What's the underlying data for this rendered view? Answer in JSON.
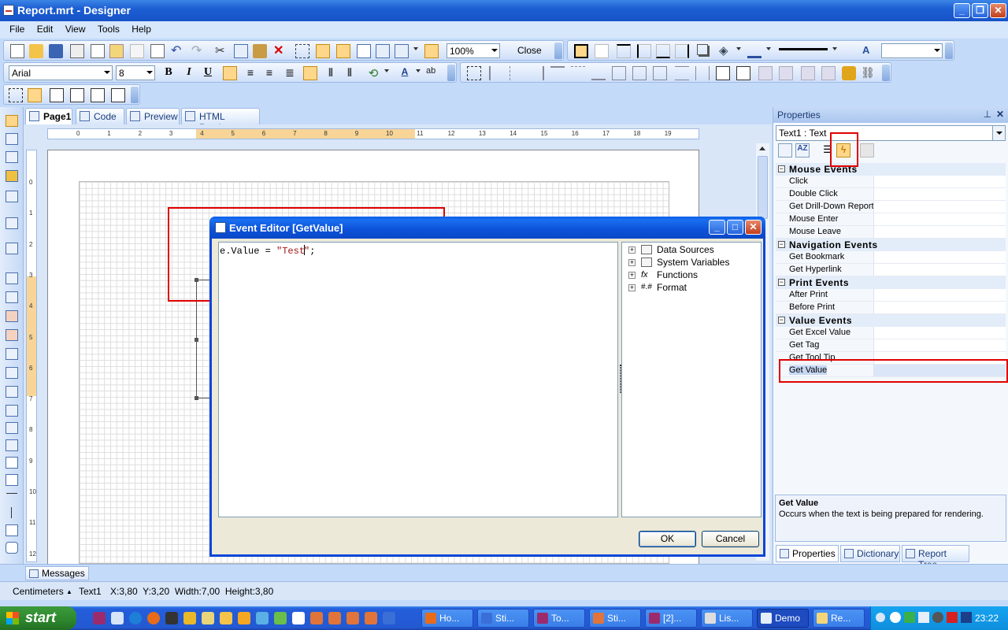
{
  "window": {
    "title": "Report.mrt - Designer"
  },
  "menu": [
    "File",
    "Edit",
    "View",
    "Tools",
    "Help"
  ],
  "toolbar": {
    "zoom": "100%",
    "close_label": "Close",
    "font_name": "Arial",
    "font_size": "8"
  },
  "tabs": [
    {
      "label": "Page1"
    },
    {
      "label": "Code"
    },
    {
      "label": "Preview"
    },
    {
      "label": "HTML Preview"
    }
  ],
  "hruler_ticks": [
    "0",
    "1",
    "2",
    "3",
    "4",
    "5",
    "6",
    "7",
    "8",
    "9",
    "10",
    "11",
    "12",
    "13",
    "14",
    "15",
    "16",
    "17",
    "18",
    "19"
  ],
  "vruler_ticks": [
    "0",
    "1",
    "2",
    "3",
    "4",
    "5",
    "6",
    "7",
    "8",
    "9",
    "10",
    "11",
    "12"
  ],
  "properties": {
    "title": "Properties",
    "object": "Text1 : Text",
    "categories": [
      {
        "name": "Mouse Events",
        "items": [
          "Click",
          "Double Click",
          "Get Drill-Down Report",
          "Mouse Enter",
          "Mouse Leave"
        ]
      },
      {
        "name": "Navigation Events",
        "items": [
          "Get Bookmark",
          "Get Hyperlink"
        ]
      },
      {
        "name": "Print Events",
        "items": [
          "After Print",
          "Before Print"
        ]
      },
      {
        "name": "Value Events",
        "items": [
          "Get Excel Value",
          "Get Tag",
          "Get Tool Tip",
          "Get Value"
        ]
      }
    ],
    "selected_item": "Get Value",
    "description_title": "Get Value",
    "description_text": "Occurs when the text is being prepared for rendering.",
    "bottom_tabs": [
      "Properties",
      "Dictionary",
      "Report Tree"
    ]
  },
  "dialog": {
    "title": "Event Editor [GetValue]",
    "code_prefix": "e.Value = ",
    "code_string_a": "\"Test",
    "code_string_b": "\"",
    "code_suffix": ";",
    "tree": [
      "Data Sources",
      "System Variables",
      "Functions",
      "Format"
    ],
    "ok_label": "OK",
    "cancel_label": "Cancel"
  },
  "messages_label": "Messages",
  "status": {
    "units": "Centimeters",
    "component": "Text1",
    "info": "X:3,80  Y:3,20  Width:7,00  Height:3,80"
  },
  "taskbar": {
    "start_label": "start",
    "buttons": [
      "Ho...",
      "Sti...",
      "To...",
      "Sti...",
      "[2]...",
      "Lis...",
      "Demo",
      "Re..."
    ],
    "active": "Demo",
    "clock": "23:22"
  },
  "colors": {
    "highlight": "#e00000",
    "title_blue": "#0a5fe8",
    "ruler_highlight": "#f8d597"
  }
}
